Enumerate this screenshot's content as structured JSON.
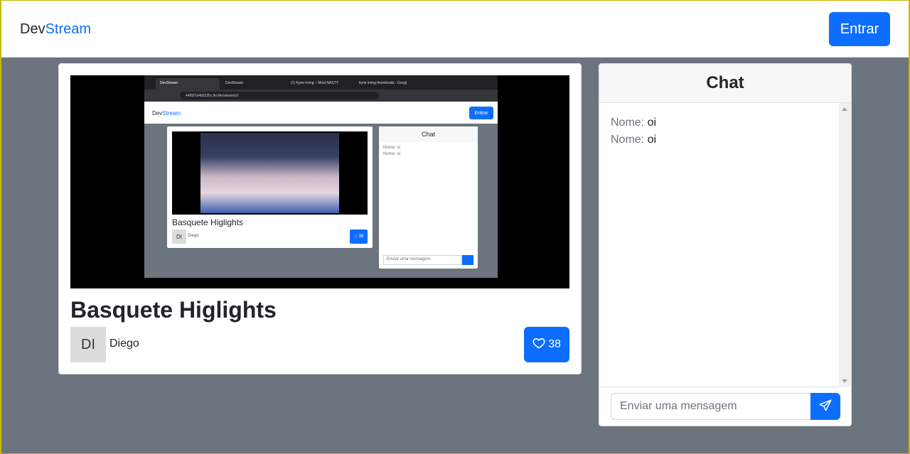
{
  "navbar": {
    "brand_prefix": "Dev",
    "brand_suffix": "Stream",
    "login_label": "Entrar"
  },
  "stream": {
    "title": "Basquete Higlights",
    "author_initials": "DI",
    "author_name": "Diego",
    "likes": "38",
    "heart_icon": "heart-icon"
  },
  "chat": {
    "title": "Chat",
    "messages": [
      {
        "name": "Nome:",
        "text": "oi"
      },
      {
        "name": "Nome:",
        "text": "oi"
      }
    ],
    "input_placeholder": "Enviar uma mensagem",
    "send_icon": "send-icon"
  },
  "player_preview": {
    "tabs": [
      {
        "label": "DevStream"
      },
      {
        "label": "DevStream"
      },
      {
        "label": "(1) Kyrie Irving ~ Most NASTY"
      },
      {
        "label": "kyrie irving thumbnails - Googl"
      }
    ],
    "url": "4485f7a4b5335c.lhr.life/streams/1",
    "brand_prefix": "Dev",
    "brand_suffix": "Stream",
    "login_label": "Entrar",
    "title": "Basquete Higlights",
    "author_initials": "DI",
    "author_name": "Diego",
    "likes": "38",
    "chat_title": "Chat",
    "chat_messages": [
      "Nome: oi",
      "Nome: oi"
    ],
    "chat_placeholder": "Enviar uma mensagem"
  },
  "colors": {
    "primary": "#0d6efd",
    "page_background": "#6c757d",
    "surface": "#ffffff"
  }
}
